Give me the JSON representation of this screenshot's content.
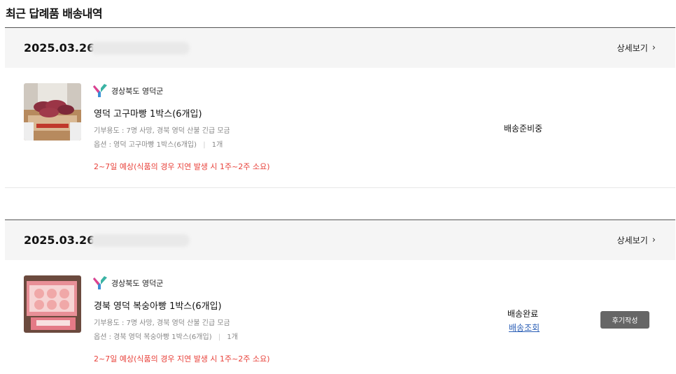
{
  "page": {
    "title": "최근 답례품 배송내역"
  },
  "orders": [
    {
      "date": "2025.03.26",
      "detail_label": "상세보기",
      "region": "경상북도 영덕군",
      "product_name": "영덕 고구마빵 1박스(6개입)",
      "purpose": "기부용도 : 7명 사망, 경북 영덕 산불 긴급 모금",
      "option": "옵션 : 영덕 고구마빵 1박스(6개입)",
      "quantity": "1개",
      "notice": "2~7일 예상(식품의 경우 지연 발생 시 1주~2주 소요)",
      "status": "배송준비중"
    },
    {
      "date": "2025.03.26",
      "detail_label": "상세보기",
      "region": "경상북도 영덕군",
      "product_name": "경북 영덕 복숭아빵 1박스(6개입)",
      "purpose": "기부용도 : 7명 사망, 경북 영덕 산불 긴급 모금",
      "option": "옵션 : 경북 영덕 복숭아빵 1박스(6개입)",
      "quantity": "1개",
      "notice": "2~7일 예상(식품의 경우 지연 발생 시 1주~2주 소요)",
      "status": "배송완료",
      "track_label": "배송조회",
      "review_label": "후기작성"
    }
  ],
  "colors": {
    "notice": "#e8413a",
    "link": "#2b5fb6",
    "review_button": "#666666"
  }
}
